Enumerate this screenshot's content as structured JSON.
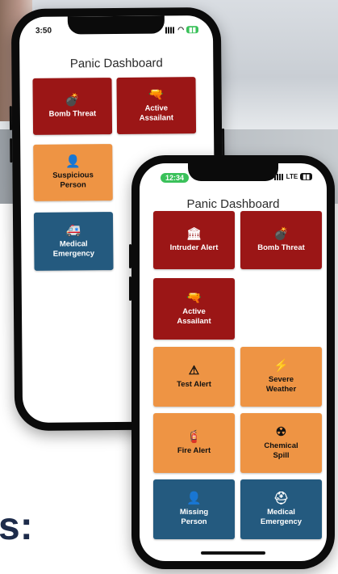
{
  "colors": {
    "red": "#9b1616",
    "orange": "#ee9444",
    "blue": "#245a7f"
  },
  "caption": "s:",
  "phone_back": {
    "status_time": "3:50",
    "title": "Panic Dashboard",
    "tiles": [
      {
        "label": "Bomb Threat",
        "icon": "bomb-icon",
        "glyph": "💣",
        "color": "red"
      },
      {
        "label": "Active\nAssailant",
        "icon": "pistol-icon",
        "glyph": "🔫",
        "color": "red"
      },
      {
        "label": "Suspicious\nPerson",
        "icon": "person-icon",
        "glyph": "👤",
        "color": "orange"
      },
      {
        "label": "Medical\nEmergency",
        "icon": "ambulance-icon",
        "glyph": "🚑",
        "color": "blue"
      }
    ]
  },
  "phone_front": {
    "status_time": "12:34",
    "status_network": "LTE",
    "title": "Panic Dashboard",
    "tiles": [
      {
        "label": "Intruder Alert",
        "icon": "building-icon",
        "glyph": "🏛",
        "color": "red"
      },
      {
        "label": "Bomb Threat",
        "icon": "bomb-icon",
        "glyph": "💣",
        "color": "red"
      },
      {
        "label": "Active\nAssailant",
        "icon": "pistol-icon",
        "glyph": "🔫",
        "color": "red"
      },
      {
        "label": "Test Alert",
        "icon": "warning-icon",
        "glyph": "⚠",
        "color": "orange"
      },
      {
        "label": "Severe\nWeather",
        "icon": "lightning-icon",
        "glyph": "⚡",
        "color": "orange"
      },
      {
        "label": "Fire Alert",
        "icon": "fire-extinguisher-icon",
        "glyph": "🧯",
        "color": "orange"
      },
      {
        "label": "Chemical\nSpill",
        "icon": "radiation-icon",
        "glyph": "☢",
        "color": "orange"
      },
      {
        "label": "Missing\nPerson",
        "icon": "person-icon",
        "glyph": "👤",
        "color": "blue"
      },
      {
        "label": "Medical\nEmergency",
        "icon": "medical-kit-icon",
        "glyph": "⛑",
        "color": "blue"
      }
    ]
  }
}
